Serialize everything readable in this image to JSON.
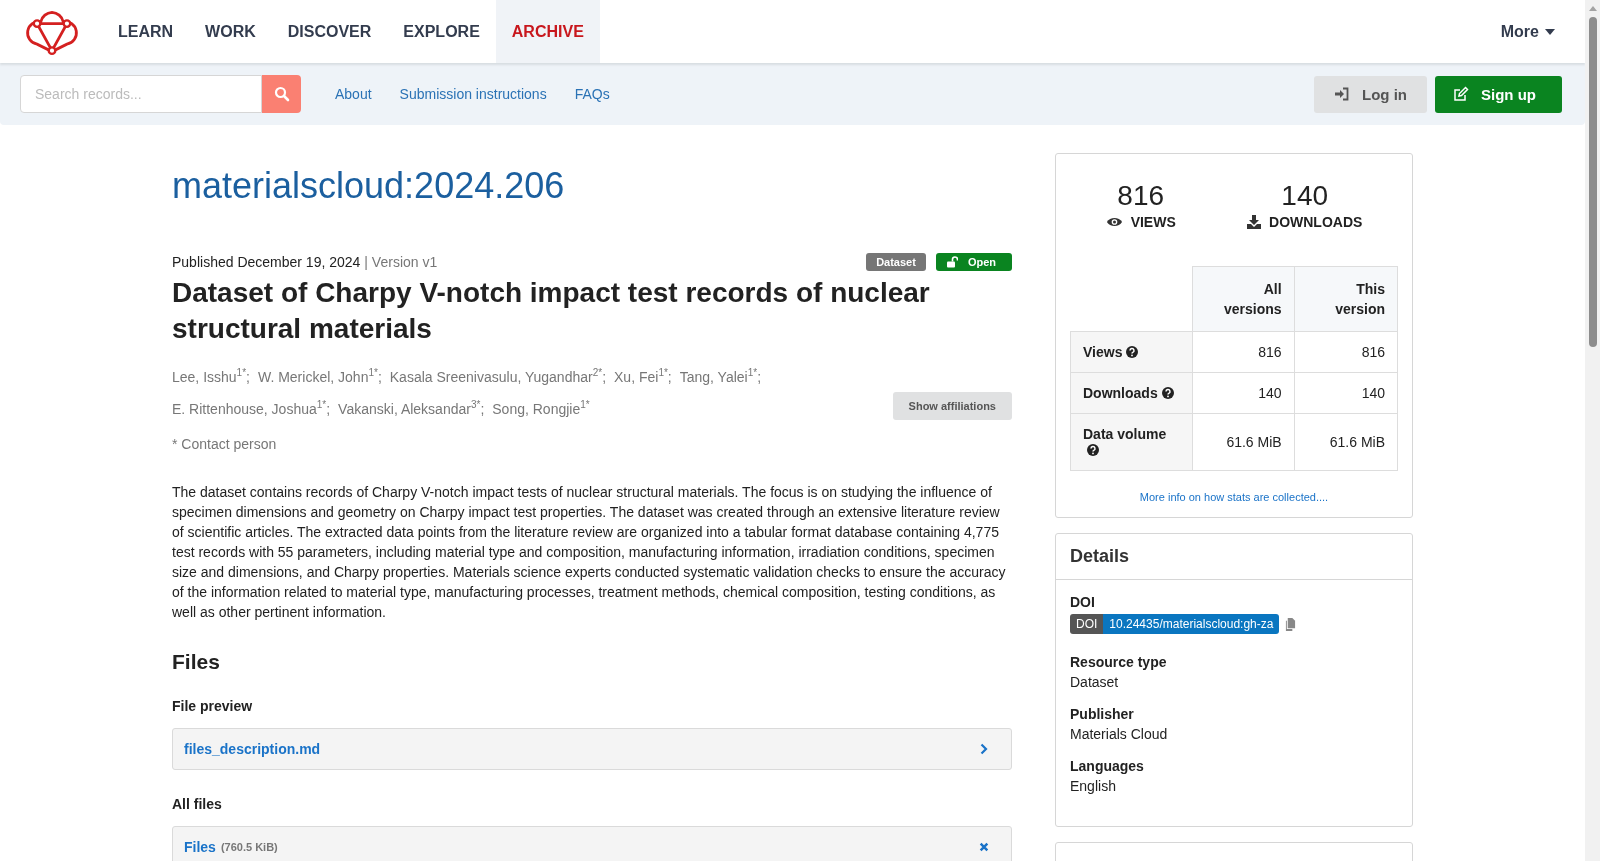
{
  "nav": {
    "items": [
      {
        "label": "LEARN",
        "selected": false
      },
      {
        "label": "WORK",
        "selected": false
      },
      {
        "label": "DISCOVER",
        "selected": false
      },
      {
        "label": "EXPLORE",
        "selected": false
      },
      {
        "label": "ARCHIVE",
        "selected": true
      }
    ],
    "more": "More"
  },
  "subbar": {
    "search_placeholder": "Search records...",
    "links": [
      "About",
      "Submission instructions",
      "FAQs"
    ],
    "login": "Log in",
    "signup": "Sign up"
  },
  "record": {
    "id": "materialscloud:2024.206",
    "published": "Published December 19, 2024",
    "version": "| Version v1",
    "badges": [
      {
        "label": "Dataset",
        "kind": "type"
      },
      {
        "label": "Open",
        "kind": "access"
      }
    ],
    "title": "Dataset of Charpy V-notch impact test records of nuclear structural materials",
    "authors": [
      "Lee, Isshu$^{1*}$;",
      "W. Merickel, John$^{1*}$;",
      "Kasala Sreenivasulu, Yugandhar$^{2*}$;",
      "Xu, Fei$^{1*}$;",
      "Tang, Yalei$^{1*}$;",
      "E. Rittenhouse, Joshua$^{1*}$;",
      "Vakanski, Aleksandar$^{3*}$;",
      "Song, Rongjie$^{1*}$"
    ],
    "show_affiliations": "Show affiliations",
    "contact_note": "* Contact person",
    "description": "The dataset contains records of Charpy V-notch impact tests of nuclear structural materials. The focus is on studying the influence of specimen dimensions and geometry on Charpy impact test properties. The dataset was created through an extensive literature review of scientific articles. The extracted data points from the literature review are organized into a tabular format database containing 4,775 test records with 55 parameters, including material type and composition, manufacturing information, irradiation conditions, specimen size and dimensions, and Charpy properties. Materials science experts conducted systematic validation checks to ensure the accuracy of the information related to material type, manufacturing processes, treatment methods, chemical composition, testing conditions, as well as other pertinent information.",
    "files": {
      "heading": "Files",
      "preview_label": "File preview",
      "preview_file": "files_description.md",
      "all_label": "All files",
      "bundle_name": "Files",
      "bundle_size": "(760.5 KiB)"
    }
  },
  "stats": {
    "counters": [
      {
        "value": "816",
        "label": "VIEWS",
        "kind": "views"
      },
      {
        "value": "140",
        "label": "DOWNLOADS",
        "kind": "downloads"
      }
    ],
    "columns": [
      "All versions",
      "This version"
    ],
    "rows": [
      {
        "label": "Views",
        "values": [
          "816",
          "816"
        ]
      },
      {
        "label": "Downloads",
        "values": [
          "140",
          "140"
        ]
      },
      {
        "label": "Data volume",
        "values": [
          "61.6 MiB",
          "61.6 MiB"
        ]
      }
    ],
    "more_info": "More info on how stats are collected...."
  },
  "details": {
    "heading": "Details",
    "fields": [
      {
        "label": "DOI",
        "kind": "doi",
        "prefix": "DOI",
        "value": "10.24435/materialscloud:gh-za"
      },
      {
        "label": "Resource type",
        "kind": "text",
        "value": "Dataset"
      },
      {
        "label": "Publisher",
        "kind": "text",
        "value": "Materials Cloud"
      },
      {
        "label": "Languages",
        "kind": "text",
        "value": "English"
      }
    ]
  }
}
